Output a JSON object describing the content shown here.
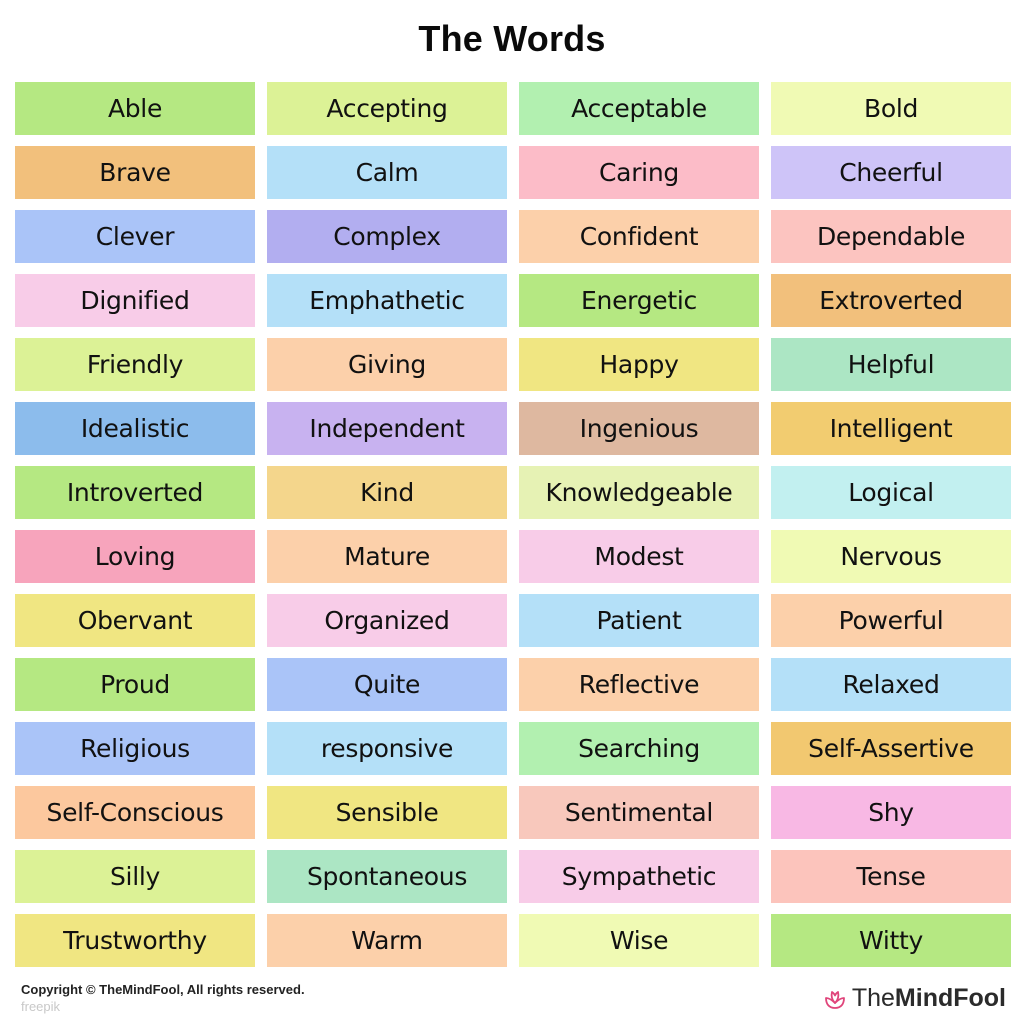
{
  "title": "The Words",
  "words": [
    {
      "label": "Able",
      "color": "#b5e882"
    },
    {
      "label": "Accepting",
      "color": "#dcf296"
    },
    {
      "label": "Acceptable",
      "color": "#b2f0b0"
    },
    {
      "label": "Bold",
      "color": "#f0fab4"
    },
    {
      "label": "Brave",
      "color": "#f2c07c"
    },
    {
      "label": "Calm",
      "color": "#b4e0f8"
    },
    {
      "label": "Caring",
      "color": "#fcbcc8"
    },
    {
      "label": "Cheerful",
      "color": "#cec4f8"
    },
    {
      "label": "Clever",
      "color": "#aac4f8"
    },
    {
      "label": "Complex",
      "color": "#b2aef0"
    },
    {
      "label": "Confident",
      "color": "#fcd0aa"
    },
    {
      "label": "Dependable",
      "color": "#fcc4c0"
    },
    {
      "label": "Dignified",
      "color": "#f8cce8"
    },
    {
      "label": "Emphathetic",
      "color": "#b4e0f8"
    },
    {
      "label": "Energetic",
      "color": "#b5e882"
    },
    {
      "label": "Extroverted",
      "color": "#f2c07c"
    },
    {
      "label": "Friendly",
      "color": "#dcf296"
    },
    {
      "label": "Giving",
      "color": "#fcd0aa"
    },
    {
      "label": "Happy",
      "color": "#f0e682"
    },
    {
      "label": "Helpful",
      "color": "#ace6c4"
    },
    {
      "label": "Idealistic",
      "color": "#8cbcec"
    },
    {
      "label": "Independent",
      "color": "#c8b2f0"
    },
    {
      "label": "Ingenious",
      "color": "#deb8a0"
    },
    {
      "label": "Intelligent",
      "color": "#f2cc70"
    },
    {
      "label": "Introverted",
      "color": "#b5e882"
    },
    {
      "label": "Kind",
      "color": "#f4d68c"
    },
    {
      "label": "Knowledgeable",
      "color": "#e6f2b4"
    },
    {
      "label": "Logical",
      "color": "#c2f0f0"
    },
    {
      "label": "Loving",
      "color": "#f7a4bc"
    },
    {
      "label": "Mature",
      "color": "#fcd0aa"
    },
    {
      "label": "Modest",
      "color": "#f8cce8"
    },
    {
      "label": "Nervous",
      "color": "#f0fab4"
    },
    {
      "label": "Obervant",
      "color": "#f0e682"
    },
    {
      "label": "Organized",
      "color": "#f8cce8"
    },
    {
      "label": "Patient",
      "color": "#b4e0f8"
    },
    {
      "label": "Powerful",
      "color": "#fcd0aa"
    },
    {
      "label": "Proud",
      "color": "#b5e882"
    },
    {
      "label": "Quite",
      "color": "#aac4f8"
    },
    {
      "label": "Reflective",
      "color": "#fcd0aa"
    },
    {
      "label": "Relaxed",
      "color": "#b4e0f8"
    },
    {
      "label": "Religious",
      "color": "#aac4f8"
    },
    {
      "label": "responsive",
      "color": "#b4e0f8"
    },
    {
      "label": "Searching",
      "color": "#b2f0b0"
    },
    {
      "label": "Self-Assertive",
      "color": "#f2c870"
    },
    {
      "label": "Self-Conscious",
      "color": "#fcc89e"
    },
    {
      "label": "Sensible",
      "color": "#f0e682"
    },
    {
      "label": "Sentimental",
      "color": "#f8c8bc"
    },
    {
      "label": "Shy",
      "color": "#f8b8e4"
    },
    {
      "label": "Silly",
      "color": "#dcf296"
    },
    {
      "label": "Spontaneous",
      "color": "#ace6c4"
    },
    {
      "label": "Sympathetic",
      "color": "#f8cce8"
    },
    {
      "label": "Tense",
      "color": "#fcc4bc"
    },
    {
      "label": "Trustworthy",
      "color": "#f0e682"
    },
    {
      "label": "Warm",
      "color": "#fcd0aa"
    },
    {
      "label": "Wise",
      "color": "#f0fab4"
    },
    {
      "label": "Witty",
      "color": "#b5e882"
    }
  ],
  "footer": {
    "copyright": "Copyright © TheMindFool, All rights reserved.",
    "credit": "freepik",
    "brand_prefix": "The",
    "brand_suffix": "MindFool",
    "brand_color": "#e0457b"
  }
}
